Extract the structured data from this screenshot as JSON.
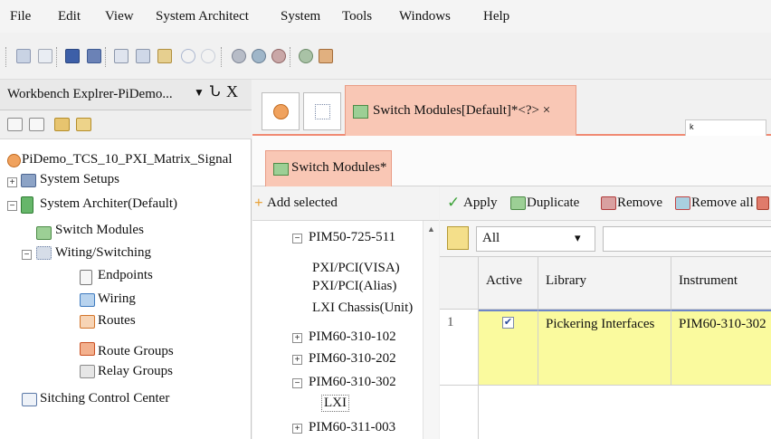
{
  "menu": {
    "items": [
      "File",
      "Edit",
      "View",
      "System Architect",
      "System",
      "Tools",
      "Windows",
      "Help"
    ]
  },
  "toolbar": {
    "icons": [
      "new-icon",
      "open-icon",
      "save-icon",
      "save-all-icon",
      "cut-icon",
      "copy-icon",
      "paste-icon",
      "undo-icon",
      "redo-icon",
      "build-icon",
      "run-icon",
      "stop-icon",
      "debug-icon",
      "deploy-icon"
    ]
  },
  "workbench": {
    "title": "Workbench Explrer-PiDemo...",
    "pin_glyph": "Ն",
    "close_glyph": "X",
    "tree": {
      "root": "PiDemo_TCS_10_PXI_Matrix_Signal",
      "system_setups": "System Setups",
      "system_architect": "System Architer(Default)",
      "switch_modules": "Switch Modules",
      "wiring_switching": "Witing/Switching",
      "endpoints": "Endpoints",
      "wiring": "Wiring",
      "routes": "Routes",
      "route_groups": "Route Groups",
      "relay_groups": "Relay Groups",
      "switching_control_center": "Sitching Control Center"
    }
  },
  "document": {
    "main_tab_label": "Switch Modules[Default]*<?> ×",
    "tooltip_text": "k",
    "inner_tab_label": "Switch Modules*"
  },
  "modules": {
    "add_selected_label": "Add selected",
    "items": {
      "pim50": "PIM50-725-511",
      "pxi_visa": "PXI/PCI(VISA)",
      "pxi_alias": "PXI/PCI(Alias)",
      "lxi_chassis": "LXI Chassis(Unit)",
      "pim60_102": "PIM60-310-102",
      "pim60_202": "PIM60-310-202",
      "pim60_302": "PIM60-310-302",
      "lxi": "LXI",
      "pim60_311": "PIM60-311-003"
    }
  },
  "actions": {
    "apply": "Apply",
    "duplicate": "Duplicate",
    "remove": "Remove",
    "remove_all": "Remove all"
  },
  "filter": {
    "selected": "All",
    "arrow": "▾"
  },
  "grid": {
    "headers": {
      "active": "Active",
      "library": "Library",
      "instrument": "Instrument"
    },
    "rows": [
      {
        "index": "1",
        "active_mark": "✔",
        "library": "Pickering Interfaces",
        "instrument": "PIM60-310-302"
      }
    ]
  },
  "colors": {
    "tab_active": "#f9c7b5",
    "tab_border": "#e99c85",
    "row_highlight": "#fafa9e",
    "selection_border": "#6e86c8"
  }
}
